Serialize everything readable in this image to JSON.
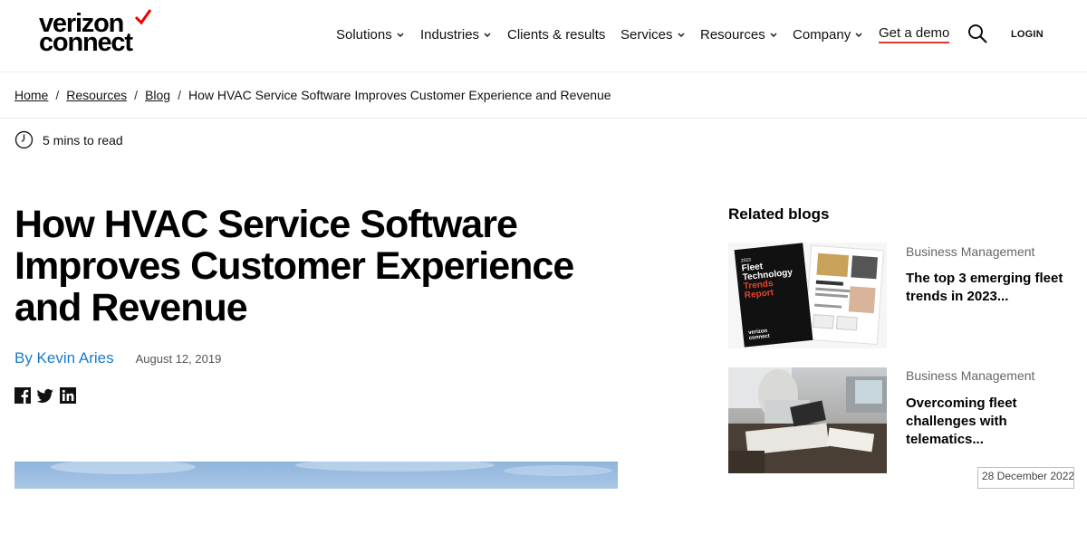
{
  "logo": {
    "line1": "verizon",
    "line2": "connect",
    "check_color": "#ee0000"
  },
  "nav": {
    "items": [
      {
        "label": "Solutions",
        "dropdown": true
      },
      {
        "label": "Industries",
        "dropdown": true
      },
      {
        "label": "Clients & results",
        "dropdown": false
      },
      {
        "label": "Services",
        "dropdown": true
      },
      {
        "label": "Resources",
        "dropdown": true
      },
      {
        "label": "Company",
        "dropdown": true
      }
    ],
    "demo_label": "Get a demo",
    "search_icon": "search-icon",
    "login_label": "LOGIN"
  },
  "breadcrumb": {
    "home": "Home",
    "resources": "Resources",
    "blog": "Blog",
    "current": "How HVAC Service Software Improves Customer Experience and Revenue",
    "separator": "/"
  },
  "article": {
    "read_time": "5 mins to read",
    "title": "How HVAC Service Software Improves Customer Experience and Revenue",
    "author": "By Kevin Aries",
    "date": "August 12, 2019",
    "share_icons": [
      "facebook-icon",
      "twitter-icon",
      "linkedin-icon"
    ]
  },
  "related": {
    "heading": "Related blogs",
    "cards": [
      {
        "category": "Business Management",
        "title": "The top 3 emerging fleet trends in 2023...",
        "image_text": {
          "year": "2023",
          "line1": "Fleet",
          "line2": "Technology",
          "line3": "Trends",
          "line4": "Report",
          "brand1": "verizon",
          "brand2": "connect"
        }
      },
      {
        "category": "Business Management",
        "title": "Overcoming fleet challenges with telematics..."
      }
    ]
  },
  "date_stamp": "28 December 2022",
  "colors": {
    "accent_red": "#e53935",
    "author_blue": "#1a7bc9"
  }
}
